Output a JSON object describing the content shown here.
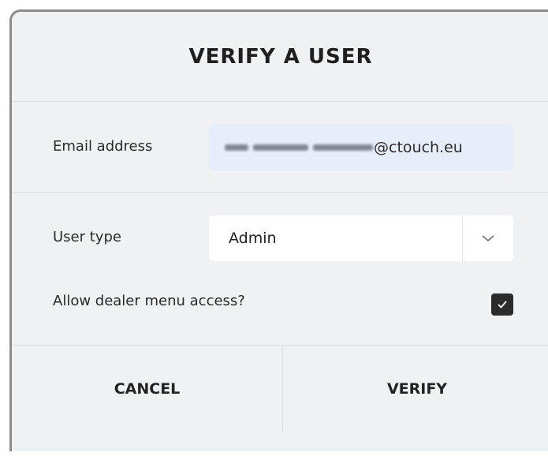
{
  "dialog": {
    "title": "VERIFY A USER"
  },
  "email": {
    "label": "Email address",
    "value_visible_suffix": "@ctouch.eu"
  },
  "user_type": {
    "label": "User type",
    "selected": "Admin",
    "chevron_icon": "chevron-down-icon"
  },
  "dealer_access": {
    "label": "Allow dealer menu access?",
    "checked": true,
    "check_icon": "checkmark-icon"
  },
  "footer": {
    "cancel_label": "CANCEL",
    "verify_label": "VERIFY"
  }
}
